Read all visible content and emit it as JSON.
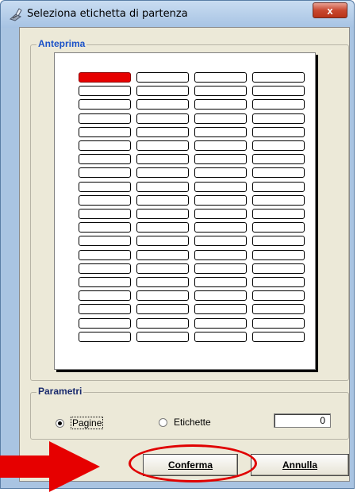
{
  "window": {
    "title": "Seleziona etichetta di partenza",
    "close_label": "x"
  },
  "preview": {
    "legend": "Anteprima",
    "columns": 4,
    "rows": 20,
    "selected_index": 0,
    "selected_color": "#e60000"
  },
  "params": {
    "legend": "Parametri",
    "option_pages": "Pagine",
    "option_labels": "Etichette",
    "selected_option": "Pagine",
    "value": "0"
  },
  "buttons": {
    "confirm": "Conferma",
    "cancel": "Annulla"
  },
  "annotations": {
    "arrow_color": "#e60000",
    "oval_color": "#e00000"
  }
}
